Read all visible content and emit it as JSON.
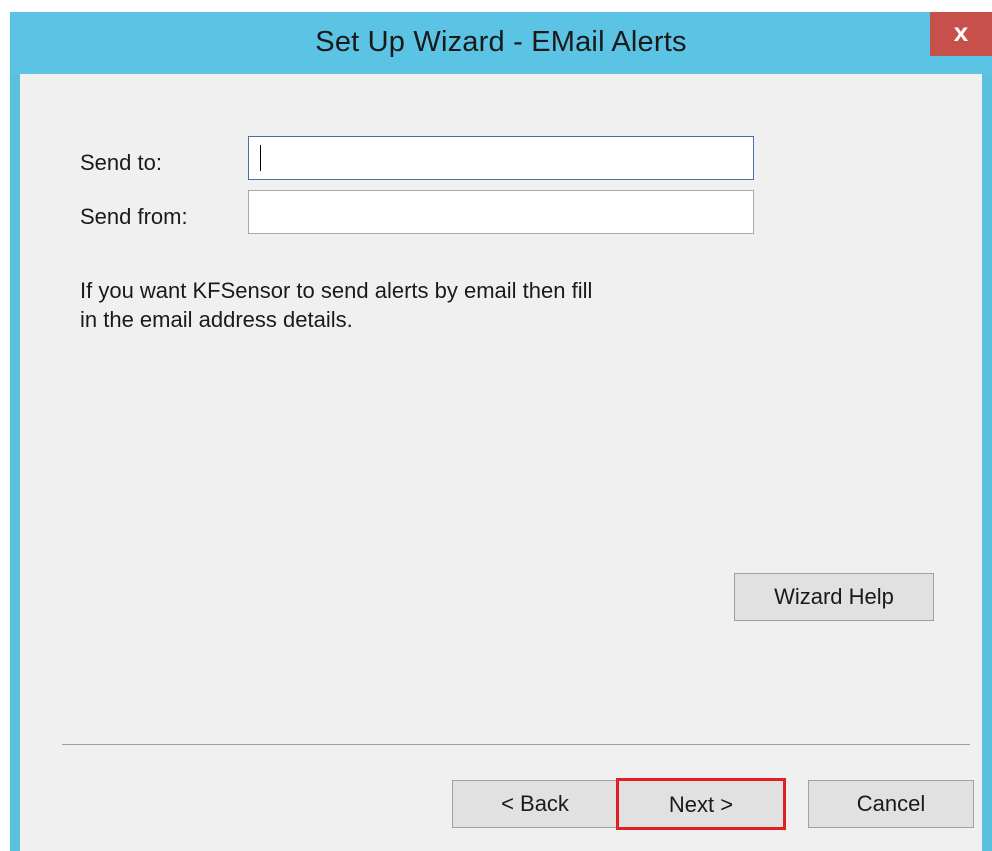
{
  "window": {
    "title": "Set Up Wizard - EMail Alerts",
    "close_label": "x"
  },
  "form": {
    "send_to_label": "Send to:",
    "send_to_value": "",
    "send_from_label": "Send from:",
    "send_from_value": ""
  },
  "info": {
    "line1": "If you want KFSensor to send alerts by email then fill",
    "line2": "in the email address details."
  },
  "buttons": {
    "wizard_help": "Wizard Help",
    "back": "< Back",
    "next": "Next >",
    "cancel": "Cancel"
  },
  "colors": {
    "titlebar": "#5bc3e3",
    "close": "#c7504a",
    "highlight": "#e02020",
    "background": "#f0f0f0"
  }
}
